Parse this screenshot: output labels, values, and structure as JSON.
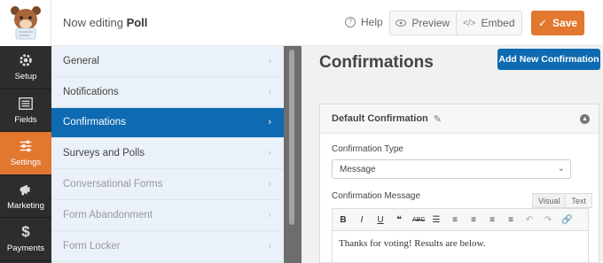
{
  "header": {
    "editing_prefix": "Now editing",
    "form_name": "Poll",
    "help_label": "Help",
    "preview_label": "Preview",
    "embed_label": "Embed",
    "save_label": "Save"
  },
  "left_nav": [
    {
      "label": "Setup",
      "icon": "gear-icon"
    },
    {
      "label": "Fields",
      "icon": "list-icon"
    },
    {
      "label": "Settings",
      "icon": "sliders-icon",
      "active": true
    },
    {
      "label": "Marketing",
      "icon": "megaphone-icon"
    },
    {
      "label": "Payments",
      "icon": "dollar-icon"
    }
  ],
  "settings_menu": [
    {
      "label": "General"
    },
    {
      "label": "Notifications"
    },
    {
      "label": "Confirmations",
      "active": true
    },
    {
      "label": "Surveys and Polls"
    },
    {
      "label": "Conversational Forms",
      "muted": true
    },
    {
      "label": "Form Abandonment",
      "muted": true
    },
    {
      "label": "Form Locker",
      "muted": true
    }
  ],
  "main": {
    "title": "Confirmations",
    "add_button": "Add New Confirmation",
    "card": {
      "title": "Default Confirmation",
      "type_label": "Confirmation Type",
      "type_value": "Message",
      "message_label": "Confirmation Message",
      "tab_visual": "Visual",
      "tab_text": "Text",
      "message_text": "Thanks for voting! Results are below."
    }
  },
  "colors": {
    "accent_orange": "#e27730",
    "accent_blue": "#0e6ab1",
    "nav_dark": "#2d2d2d",
    "menu_bg": "#eaf1f8"
  }
}
